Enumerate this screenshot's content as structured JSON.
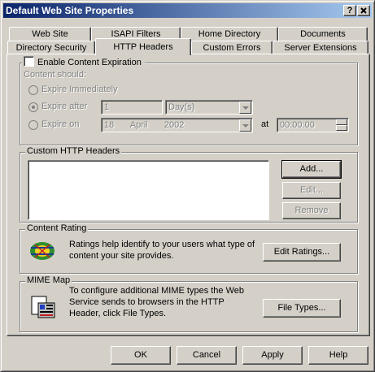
{
  "window": {
    "title": "Default Web Site Properties",
    "help_btn": "?",
    "close_btn": "X"
  },
  "tabs": {
    "back_row": [
      "Web Site",
      "ISAPI Filters",
      "Home Directory",
      "Documents"
    ],
    "front_row": [
      "Directory Security",
      "HTTP Headers",
      "Custom Errors",
      "Server Extensions"
    ],
    "active": "HTTP Headers"
  },
  "expiration": {
    "checkbox_label": "Enable Content Expiration",
    "checked": false,
    "content_should": "Content should:",
    "opt_immediately": "Expire Immediately",
    "opt_after": "Expire after",
    "opt_on": "Expire on",
    "after_value": "1",
    "after_unit": "Day(s)",
    "on_day": "18",
    "on_month": "April",
    "on_year": "2002",
    "at_label": "at",
    "time_value": "00:00:00"
  },
  "custom_headers": {
    "label": "Custom HTTP Headers",
    "items": [],
    "add": "Add...",
    "edit": "Edit...",
    "remove": "Remove"
  },
  "rating": {
    "label": "Content Rating",
    "description": [
      "Ratings help identify to your users what type of",
      "content your site provides."
    ],
    "edit_button": "Edit Ratings..."
  },
  "mime": {
    "label": "MIME Map",
    "description": [
      "To configure additional MIME types the Web",
      "Service sends to browsers in the HTTP",
      "Header, click File Types."
    ],
    "button": "File Types..."
  },
  "footer": {
    "ok": "OK",
    "cancel": "Cancel",
    "apply": "Apply",
    "help": "Help"
  },
  "colors": {
    "title_start": "#0a246a",
    "title_end": "#a6caf0",
    "face": "#d4d0c8"
  }
}
